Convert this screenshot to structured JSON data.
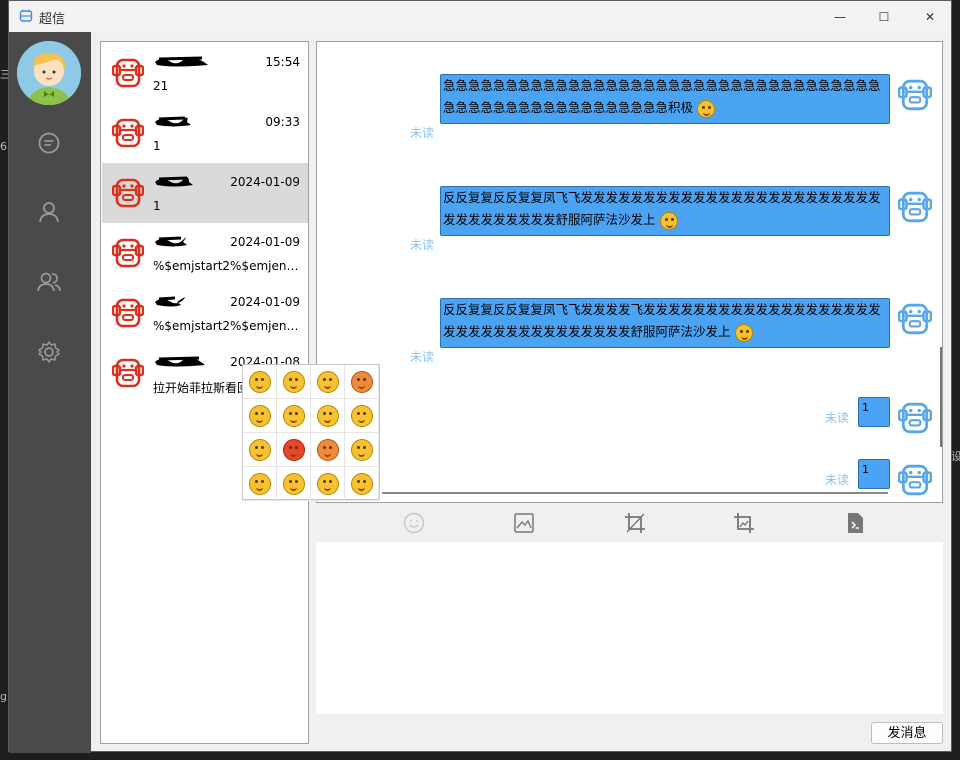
{
  "app": {
    "title": "超信"
  },
  "window_controls": {
    "minimize": "—",
    "maximize": "☐",
    "close": "✕"
  },
  "sidebar": {
    "items": [
      {
        "icon": "chat-icon"
      },
      {
        "icon": "user-icon"
      },
      {
        "icon": "group-icon"
      },
      {
        "icon": "settings-icon"
      }
    ]
  },
  "edge_marks": [
    "三",
    "6",
    "g",
    "设"
  ],
  "contacts": [
    {
      "time": "15:54",
      "message": "21"
    },
    {
      "time": "09:33",
      "message": "1"
    },
    {
      "time": "2024-01-09",
      "message": "1",
      "selected": true
    },
    {
      "time": "2024-01-09",
      "message": "%$emjstart2%$emjend..."
    },
    {
      "time": "2024-01-09",
      "message": "%$emjstart2%$emjend..."
    },
    {
      "time": "2024-01-08",
      "message": "拉开始菲拉斯看回"
    }
  ],
  "messages": [
    {
      "text": "急急急急急急急急急急急急急急急急急急急急急急急急急急急急急急急急急急急急急急急急急急急急急急急急急急急急急积极",
      "emoji": true,
      "status": "未读"
    },
    {
      "text": "反反复复反反复复凤飞飞发发发发发发发发发发发发发发发发发发发发发发发发发发发发发发发发发舒服阿萨法沙发上",
      "emoji": true,
      "status": "未读"
    },
    {
      "text": "反反复复反反复复凤飞飞发发发发飞发发发发发发发发发发发发发发发发发发发发发发发发发发发发发发发发发发舒服阿萨法沙发上",
      "emoji": true,
      "status": "未读"
    },
    {
      "text": "1",
      "emoji": false,
      "status": "未读"
    },
    {
      "text": "1",
      "emoji": false,
      "status": "未读"
    }
  ],
  "toolbar": {
    "items": [
      "emoji-icon",
      "image-icon",
      "crop-icon",
      "screenshot-icon",
      "file-icon"
    ]
  },
  "input": {
    "value": ""
  },
  "send_button": {
    "label": "发消息"
  },
  "emoji_panel": {
    "rows": 4,
    "cols": 4
  },
  "colors": {
    "bubble": "#4aa3f3",
    "unread": "#8fc3ea",
    "sidebar": "#4a4a4a",
    "contact_avatar": "#d9311e",
    "self_avatar": "#5aa6e8"
  }
}
